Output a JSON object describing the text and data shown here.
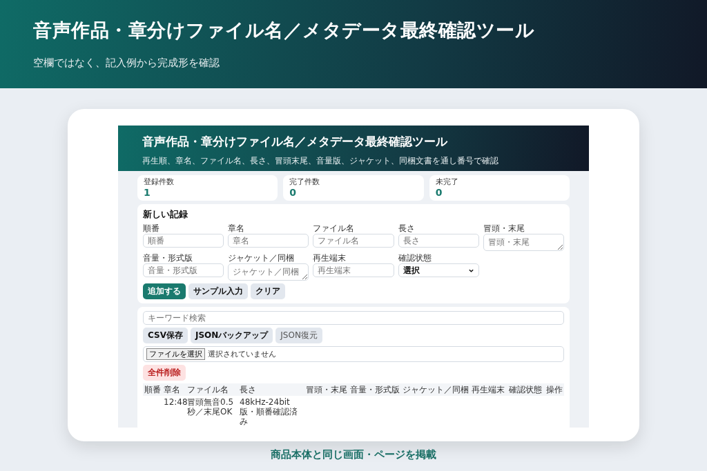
{
  "banner": {
    "title": "音声作品・章分けファイル名／メタデータ最終確認ツール",
    "subtitle": "空欄ではなく、記入例から完成形を確認"
  },
  "app": {
    "header": {
      "title": "音声作品・章分けファイル名／メタデータ最終確認ツール",
      "subtitle": "再生順、章名、ファイル名、長さ、冒頭末尾、音量版、ジャケット、同梱文書を通し番号で確認"
    },
    "stats": [
      {
        "label": "登録件数",
        "value": "1"
      },
      {
        "label": "完了件数",
        "value": "0"
      },
      {
        "label": "未完了",
        "value": "0"
      }
    ],
    "form": {
      "title": "新しい記録",
      "fields": [
        {
          "label": "順番",
          "placeholder": "順番",
          "kind": "input"
        },
        {
          "label": "章名",
          "placeholder": "章名",
          "kind": "input"
        },
        {
          "label": "ファイル名",
          "placeholder": "ファイル名",
          "kind": "input"
        },
        {
          "label": "長さ",
          "placeholder": "長さ",
          "kind": "input"
        },
        {
          "label": "冒頭・末尾",
          "placeholder": "冒頭・末尾",
          "kind": "textarea"
        },
        {
          "label": "音量・形式版",
          "placeholder": "音量・形式版",
          "kind": "input"
        },
        {
          "label": "ジャケット／同梱",
          "placeholder": "ジャケット／同梱",
          "kind": "textarea"
        },
        {
          "label": "再生端末",
          "placeholder": "再生端末",
          "kind": "input"
        },
        {
          "label": "確認状態",
          "value": "選択",
          "kind": "select"
        }
      ],
      "buttons": [
        {
          "label": "追加する",
          "kind": "primary"
        },
        {
          "label": "サンプル入力",
          "kind": "secondary"
        },
        {
          "label": "クリア",
          "kind": "secondary"
        }
      ]
    },
    "list": {
      "search": {
        "placeholder": "キーワード検索"
      },
      "buttons": [
        {
          "label": "CSV保存",
          "kind": "bold"
        },
        {
          "label": "JSONバックアップ",
          "kind": "bold"
        },
        {
          "label": "JSON復元",
          "kind": "plain"
        }
      ],
      "file_button": "ファイルを選択",
      "file_status": "選択されていません",
      "danger_button": "全件削除",
      "columns": [
        "順番",
        "章名",
        "ファイル名",
        "長さ",
        "冒頭・末尾",
        "音量・形式版",
        "ジャケット／同梱",
        "再生端末",
        "確認状態",
        "操作"
      ],
      "rows": [
        {
          "chapter": "12:48",
          "file_name": "冒頭無音0.5秒／末尾OK",
          "length": "48kHz-24bit版・順番確認済み"
        }
      ]
    }
  },
  "caption": "商品本体と同じ画面・ページを掲載"
}
